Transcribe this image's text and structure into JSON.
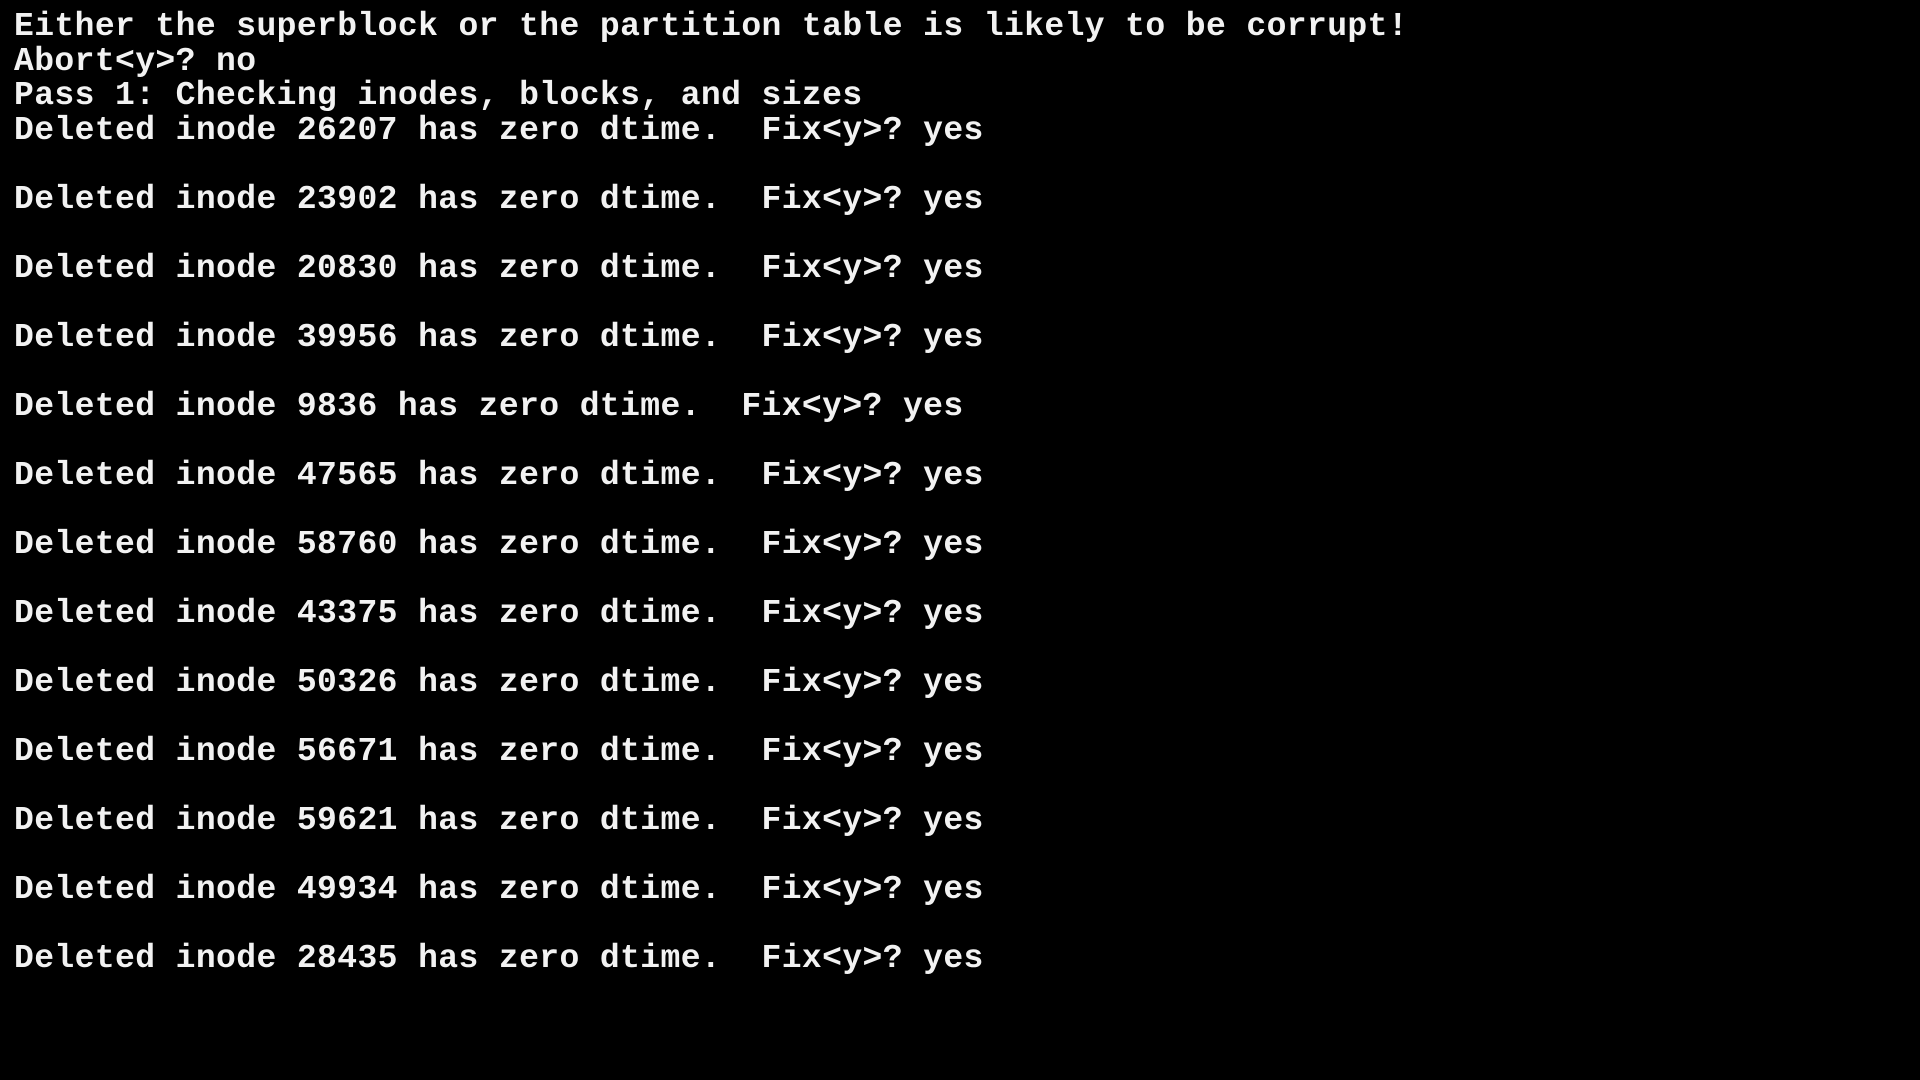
{
  "terminal": {
    "background": "#000000",
    "foreground": "#f2f2f2",
    "lines": [
      "Either the superblock or the partition table is likely to be corrupt!",
      "Abort<y>? no",
      "Pass 1: Checking inodes, blocks, and sizes",
      "Deleted inode 26207 has zero dtime.  Fix<y>? yes",
      "",
      "Deleted inode 23902 has zero dtime.  Fix<y>? yes",
      "",
      "Deleted inode 20830 has zero dtime.  Fix<y>? yes",
      "",
      "Deleted inode 39956 has zero dtime.  Fix<y>? yes",
      "",
      "Deleted inode 9836 has zero dtime.  Fix<y>? yes",
      "",
      "Deleted inode 47565 has zero dtime.  Fix<y>? yes",
      "",
      "Deleted inode 58760 has zero dtime.  Fix<y>? yes",
      "",
      "Deleted inode 43375 has zero dtime.  Fix<y>? yes",
      "",
      "Deleted inode 50326 has zero dtime.  Fix<y>? yes",
      "",
      "Deleted inode 56671 has zero dtime.  Fix<y>? yes",
      "",
      "Deleted inode 59621 has zero dtime.  Fix<y>? yes",
      "",
      "Deleted inode 49934 has zero dtime.  Fix<y>? yes",
      "",
      "Deleted inode 28435 has zero dtime.  Fix<y>? yes"
    ]
  }
}
